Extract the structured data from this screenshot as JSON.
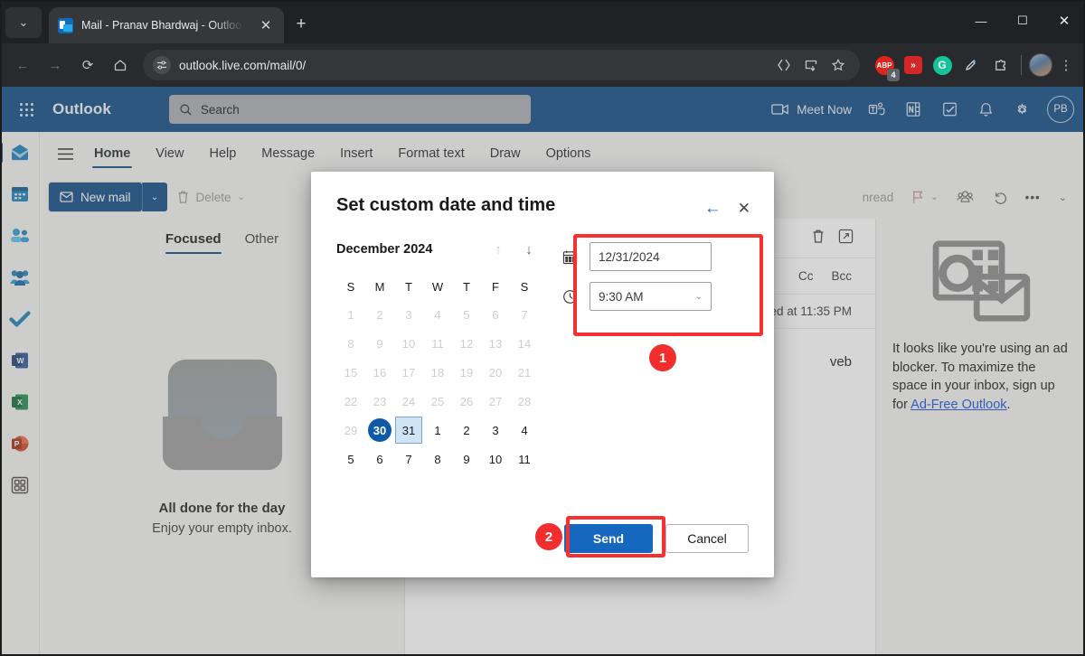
{
  "browser": {
    "tab": {
      "title": "Mail - Pranav Bhardwaj - Outloo",
      "favicon": "outlook-favicon",
      "close": "✕"
    },
    "tab_list_chevron": "⌄",
    "new_tab": "+",
    "window_controls": {
      "minimize": "—",
      "maximize": "☐",
      "close": "✕"
    },
    "nav": {
      "back": "←",
      "forward": "→",
      "reload": "⟳",
      "home": "⌂"
    },
    "url": "outlook.live.com/mail/0/",
    "omnibox_icons": [
      "split-screen-icon",
      "install-app-icon",
      "bookmark-star-icon"
    ],
    "extensions": [
      {
        "name": "adblock-extension-icon",
        "label": "ABP",
        "badge": "4"
      },
      {
        "name": "media-downloader-extension-icon",
        "label": "»"
      },
      {
        "name": "grammarly-extension-icon",
        "label": "G"
      },
      {
        "name": "eyedropper-extension-icon",
        "label": ""
      },
      {
        "name": "extensions-puzzle-icon",
        "label": ""
      }
    ],
    "menu": "⋮"
  },
  "owa": {
    "brand": "Outlook",
    "waffle": "app-launcher-icon",
    "search": {
      "placeholder": "Search",
      "icon": "search-icon"
    },
    "meet_now": "Meet Now",
    "right_icons": [
      "teams-icon",
      "onenote-icon",
      "todo-icon",
      "notifications-bell-icon",
      "settings-gear-icon"
    ],
    "avatar": "PB"
  },
  "rail": {
    "items": [
      {
        "name": "mail",
        "icon": "mail-icon"
      },
      {
        "name": "calendar",
        "icon": "calendar-icon"
      },
      {
        "name": "people",
        "icon": "people-icon"
      },
      {
        "name": "groups",
        "icon": "groups-icon"
      },
      {
        "name": "todo",
        "icon": "todo-check-icon"
      },
      {
        "name": "word",
        "icon": "word-icon",
        "glyph": "W"
      },
      {
        "name": "excel",
        "icon": "excel-icon",
        "glyph": "X"
      },
      {
        "name": "powerpoint",
        "icon": "powerpoint-icon",
        "glyph": "P"
      },
      {
        "name": "more-apps",
        "icon": "apps-grid-icon"
      }
    ]
  },
  "ribbon": {
    "hamburger": "menu-icon",
    "tabs": [
      {
        "label": "Home",
        "active": true
      },
      {
        "label": "View",
        "active": false
      },
      {
        "label": "Help",
        "active": false
      },
      {
        "label": "Message",
        "active": false
      },
      {
        "label": "Insert",
        "active": false
      },
      {
        "label": "Format text",
        "active": false
      },
      {
        "label": "Draw",
        "active": false
      },
      {
        "label": "Options",
        "active": false
      }
    ]
  },
  "commandbar": {
    "new_mail": "New mail",
    "new_mail_chevron": "⌄",
    "delete": "Delete",
    "delete_chevron": "⌄",
    "unread": "nread",
    "flag_chevron": "⌄",
    "more": "•••",
    "collapse_chevron": "⌄"
  },
  "maillist": {
    "tabs": [
      {
        "label": "Focused",
        "active": true
      },
      {
        "label": "Other",
        "active": false
      }
    ],
    "empty_title": "All done for the day",
    "empty_subtitle": "Enjoy your empty inbox."
  },
  "readpane": {
    "tools": [
      "delete-icon",
      "popout-icon"
    ],
    "cc": "Cc",
    "bcc": "Bcc",
    "schedule_note": "ed at 11:35 PM",
    "body_snippet": "veb"
  },
  "adpane": {
    "logo": "outlook-logo-icon",
    "text_before": "It looks like you're using an ad blocker. To maximize the space in your inbox, sign up for ",
    "link": "Ad-Free Outlook",
    "text_after": "."
  },
  "dialog": {
    "title": "Set custom date and time",
    "back": "←",
    "close": "✕",
    "calendar": {
      "month_label": "December 2024",
      "prev_icon": "↑",
      "next_icon": "↓",
      "weekdays": [
        "S",
        "M",
        "T",
        "W",
        "T",
        "F",
        "S"
      ],
      "weeks": [
        [
          {
            "d": "1",
            "s": "dim"
          },
          {
            "d": "2",
            "s": "dim"
          },
          {
            "d": "3",
            "s": "dim"
          },
          {
            "d": "4",
            "s": "dim"
          },
          {
            "d": "5",
            "s": "dim"
          },
          {
            "d": "6",
            "s": "dim"
          },
          {
            "d": "7",
            "s": "dim"
          }
        ],
        [
          {
            "d": "8",
            "s": "dim"
          },
          {
            "d": "9",
            "s": "dim"
          },
          {
            "d": "10",
            "s": "dim"
          },
          {
            "d": "11",
            "s": "dim"
          },
          {
            "d": "12",
            "s": "dim"
          },
          {
            "d": "13",
            "s": "dim"
          },
          {
            "d": "14",
            "s": "dim"
          }
        ],
        [
          {
            "d": "15",
            "s": "dim"
          },
          {
            "d": "16",
            "s": "dim"
          },
          {
            "d": "17",
            "s": "dim"
          },
          {
            "d": "18",
            "s": "dim"
          },
          {
            "d": "19",
            "s": "dim"
          },
          {
            "d": "20",
            "s": "dim"
          },
          {
            "d": "21",
            "s": "dim"
          }
        ],
        [
          {
            "d": "22",
            "s": "dim"
          },
          {
            "d": "23",
            "s": "dim"
          },
          {
            "d": "24",
            "s": "dim"
          },
          {
            "d": "25",
            "s": "dim"
          },
          {
            "d": "26",
            "s": "dim"
          },
          {
            "d": "27",
            "s": "dim"
          },
          {
            "d": "28",
            "s": "dim"
          }
        ],
        [
          {
            "d": "29",
            "s": "dim"
          },
          {
            "d": "30",
            "s": "selected"
          },
          {
            "d": "31",
            "s": "today"
          },
          {
            "d": "1",
            "s": "normal"
          },
          {
            "d": "2",
            "s": "normal"
          },
          {
            "d": "3",
            "s": "normal"
          },
          {
            "d": "4",
            "s": "normal"
          }
        ],
        [
          {
            "d": "5",
            "s": "normal"
          },
          {
            "d": "6",
            "s": "normal"
          },
          {
            "d": "7",
            "s": "normal"
          },
          {
            "d": "8",
            "s": "normal"
          },
          {
            "d": "9",
            "s": "normal"
          },
          {
            "d": "10",
            "s": "normal"
          },
          {
            "d": "11",
            "s": "normal"
          }
        ]
      ]
    },
    "date_field": {
      "icon": "calendar-icon",
      "value": "12/31/2024"
    },
    "time_field": {
      "icon": "clock-icon",
      "value": "9:30 AM",
      "chevron": "⌄"
    },
    "send": "Send",
    "cancel": "Cancel"
  },
  "annotations": {
    "badge1": "1",
    "badge2": "2",
    "color": "#f53030"
  }
}
